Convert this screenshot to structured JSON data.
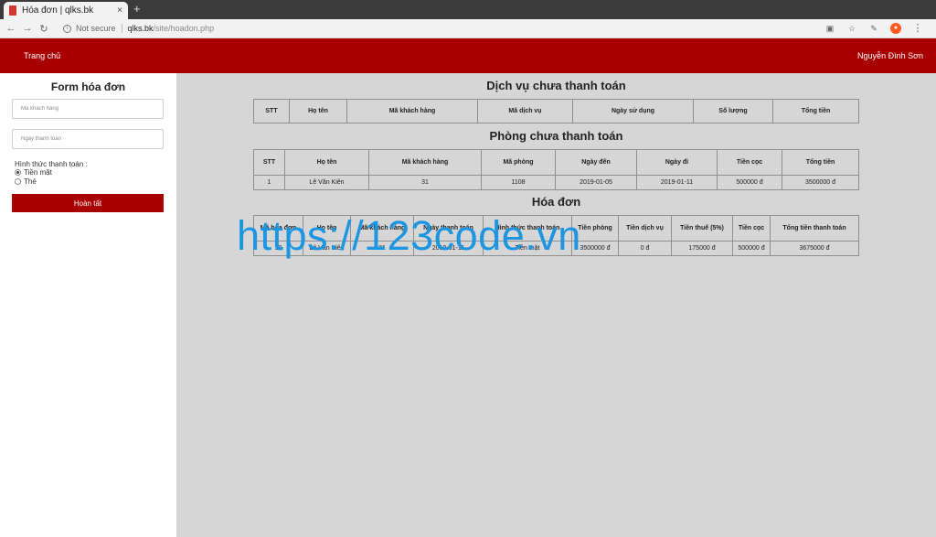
{
  "browser": {
    "tab_title": "Hóa đơn | qlks.bk",
    "tab_close": "×",
    "new_tab": "+",
    "not_secure": "Not secure",
    "url_host": "qlks.bk",
    "url_path": "/site/hoadon.php"
  },
  "navbar": {
    "home": "Trang chủ",
    "user": "Nguyễn Đình Sơn"
  },
  "form": {
    "title": "Form hóa đơn",
    "customer_placeholder": "Mã khách hàng",
    "date_placeholder": "Ngày thanh toán",
    "payment_label": "Hình thức thanh toán :",
    "option_cash": "Tiền mặt",
    "option_card": "Thẻ",
    "submit": "Hoàn tất"
  },
  "unpaid_services": {
    "title": "Dịch vụ chưa thanh toán",
    "headers": [
      "STT",
      "Họ tên",
      "Mã khách hàng",
      "Mã dịch vụ",
      "Ngày sử dụng",
      "Số lượng",
      "Tổng tiền"
    ],
    "rows": []
  },
  "unpaid_rooms": {
    "title": "Phòng chưa thanh toán",
    "headers": [
      "STT",
      "Họ tên",
      "Mã khách hàng",
      "Mã phòng",
      "Ngày đến",
      "Ngày đi",
      "Tiền cọc",
      "Tổng tiền"
    ],
    "rows": [
      [
        "1",
        "Lê Văn Kiên",
        "31",
        "1108",
        "2019-01-05",
        "2019-01-11",
        "500000 đ",
        "3500000 đ"
      ]
    ]
  },
  "invoices": {
    "title": "Hóa đơn",
    "headers": [
      "Mã hóa đơn",
      "Họ tên",
      "Mã khách hàng",
      "Ngày thanh toán",
      "Hình thức thanh toán",
      "Tiền phòng",
      "Tiền dịch vụ",
      "Tiền thuế (5%)",
      "Tiền cọc",
      "Tổng tiền thanh toán"
    ],
    "rows": [
      [
        "12",
        "Lê Văn Kiên",
        "31",
        "2019-01-11",
        "Tiền mặt",
        "3500000 đ",
        "0 đ",
        "175000 đ",
        "500000 đ",
        "3675000 đ"
      ]
    ]
  },
  "watermark": "https://123code.vn"
}
